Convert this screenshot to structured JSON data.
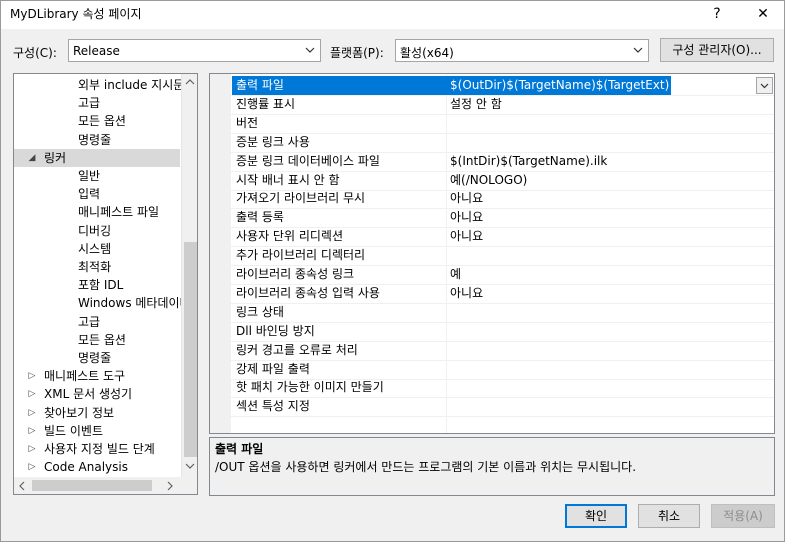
{
  "window": {
    "title": "MyDLibrary 속성 페이지",
    "help_glyph": "?",
    "close_glyph": "✕"
  },
  "toolbar": {
    "config_label": "구성(C):",
    "config_value": "Release",
    "platform_label": "플랫폼(P):",
    "platform_value": "활성(x64)",
    "config_manager_button": "구성 관리자(O)..."
  },
  "tree": {
    "items": [
      {
        "label": "외부 include 지시문"
      },
      {
        "label": "고급"
      },
      {
        "label": "모든 옵션"
      },
      {
        "label": "명령줄"
      },
      {
        "label": "링커"
      },
      {
        "label": "일반"
      },
      {
        "label": "입력"
      },
      {
        "label": "매니페스트 파일"
      },
      {
        "label": "디버깅"
      },
      {
        "label": "시스템"
      },
      {
        "label": "최적화"
      },
      {
        "label": "포함 IDL"
      },
      {
        "label": "Windows 메타데이터"
      },
      {
        "label": "고급"
      },
      {
        "label": "모든 옵션"
      },
      {
        "label": "명령줄"
      },
      {
        "label": "매니페스트 도구"
      },
      {
        "label": "XML 문서 생성기"
      },
      {
        "label": "찾아보기 정보"
      },
      {
        "label": "빌드 이벤트"
      },
      {
        "label": "사용자 지정 빌드 단계"
      },
      {
        "label": "Code Analysis"
      }
    ]
  },
  "properties": {
    "rows": [
      {
        "name": "출력 파일",
        "value": "$(OutDir)$(TargetName)$(TargetExt)"
      },
      {
        "name": "진행률 표시",
        "value": "설정 안 함"
      },
      {
        "name": "버전",
        "value": ""
      },
      {
        "name": "증분 링크 사용",
        "value": ""
      },
      {
        "name": "증분 링크 데이터베이스 파일",
        "value": "$(IntDir)$(TargetName).ilk"
      },
      {
        "name": "시작 배너 표시 안 함",
        "value": "예(/NOLOGO)"
      },
      {
        "name": "가져오기 라이브러리 무시",
        "value": "아니요"
      },
      {
        "name": "출력 등록",
        "value": "아니요"
      },
      {
        "name": "사용자 단위 리디렉션",
        "value": "아니요"
      },
      {
        "name": "추가 라이브러리 디렉터리",
        "value": ""
      },
      {
        "name": "라이브러리 종속성 링크",
        "value": "예"
      },
      {
        "name": "라이브러리 종속성 입력 사용",
        "value": "아니요"
      },
      {
        "name": "링크 상태",
        "value": ""
      },
      {
        "name": "Dll 바인딩 방지",
        "value": ""
      },
      {
        "name": "링커 경고를 오류로 처리",
        "value": ""
      },
      {
        "name": "강제 파일 출력",
        "value": ""
      },
      {
        "name": "핫 패치 가능한 이미지 만들기",
        "value": ""
      },
      {
        "name": "섹션 특성 지정",
        "value": ""
      }
    ]
  },
  "description": {
    "title": "출력 파일",
    "text": "/OUT 옵션을 사용하면 링커에서 만드는 프로그램의 기본 이름과 위치는 무시됩니다."
  },
  "buttons": {
    "ok": "확인",
    "cancel": "취소",
    "apply": "적용(A)"
  },
  "colors": {
    "selection": "#0078d7",
    "tree_selection": "#d9d9d9"
  }
}
